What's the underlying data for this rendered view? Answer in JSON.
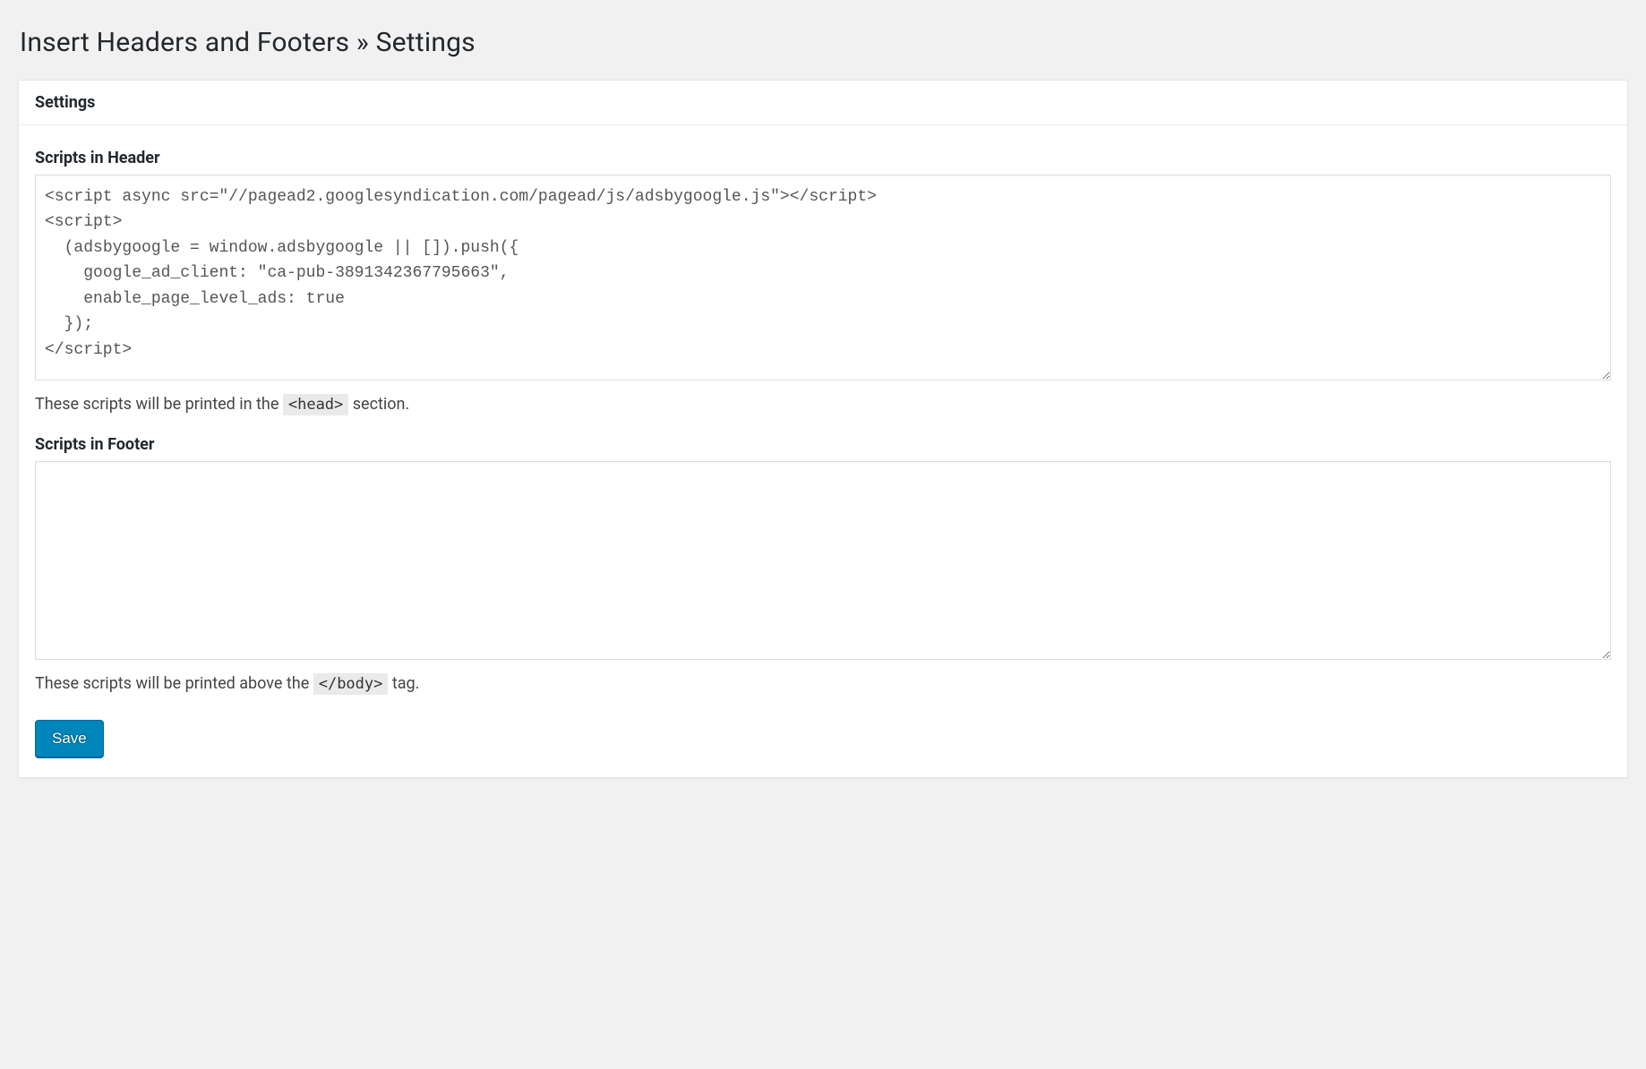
{
  "page": {
    "title": "Insert Headers and Footers » Settings"
  },
  "panel": {
    "heading": "Settings"
  },
  "header": {
    "label": "Scripts in Header",
    "value": "<script async src=\"//pagead2.googlesyndication.com/pagead/js/adsbygoogle.js\"></script>\n<script>\n  (adsbygoogle = window.adsbygoogle || []).push({\n    google_ad_client: \"ca-pub-3891342367795663\",\n    enable_page_level_ads: true\n  });\n</script>",
    "description_before": "These scripts will be printed in the ",
    "description_tag": "<head>",
    "description_after": " section."
  },
  "footer": {
    "label": "Scripts in Footer",
    "value": "",
    "description_before": "These scripts will be printed above the ",
    "description_tag": "</body>",
    "description_after": " tag."
  },
  "actions": {
    "save_label": "Save"
  }
}
